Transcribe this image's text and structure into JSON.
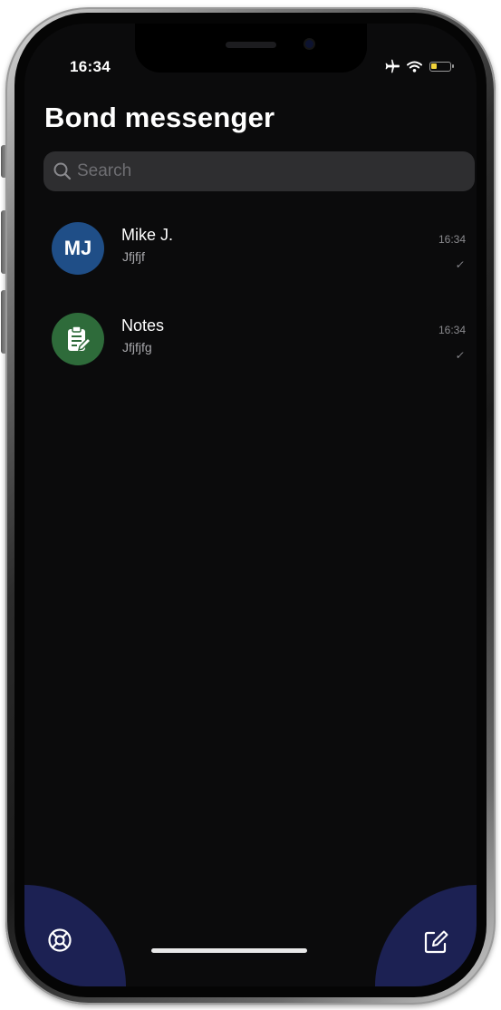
{
  "status_bar": {
    "time": "16:34",
    "icons": [
      "airplane-icon",
      "wifi-icon",
      "battery-icon"
    ],
    "battery_level": 0.3,
    "battery_color": "#f1d33b"
  },
  "header": {
    "title": "Bond messenger"
  },
  "search": {
    "placeholder": "Search",
    "value": ""
  },
  "chats": [
    {
      "name": "Mike J.",
      "preview": "Jfjfjf",
      "time": "16:34",
      "check": "✓",
      "avatar_text": "MJ",
      "avatar_color": "#1f4e87"
    },
    {
      "name": "Notes",
      "preview": "Jfjfjfg",
      "time": "16:34",
      "check": "✓",
      "avatar_icon": "notes-clipboard-icon",
      "avatar_color": "#2e6b3a"
    }
  ],
  "bottom_actions": {
    "left_icon": "settings-icon",
    "right_icon": "compose-icon",
    "background_color": "#1c2153"
  },
  "colors": {
    "screen_background": "#0b0b0c",
    "search_background": "#2e2e30"
  }
}
